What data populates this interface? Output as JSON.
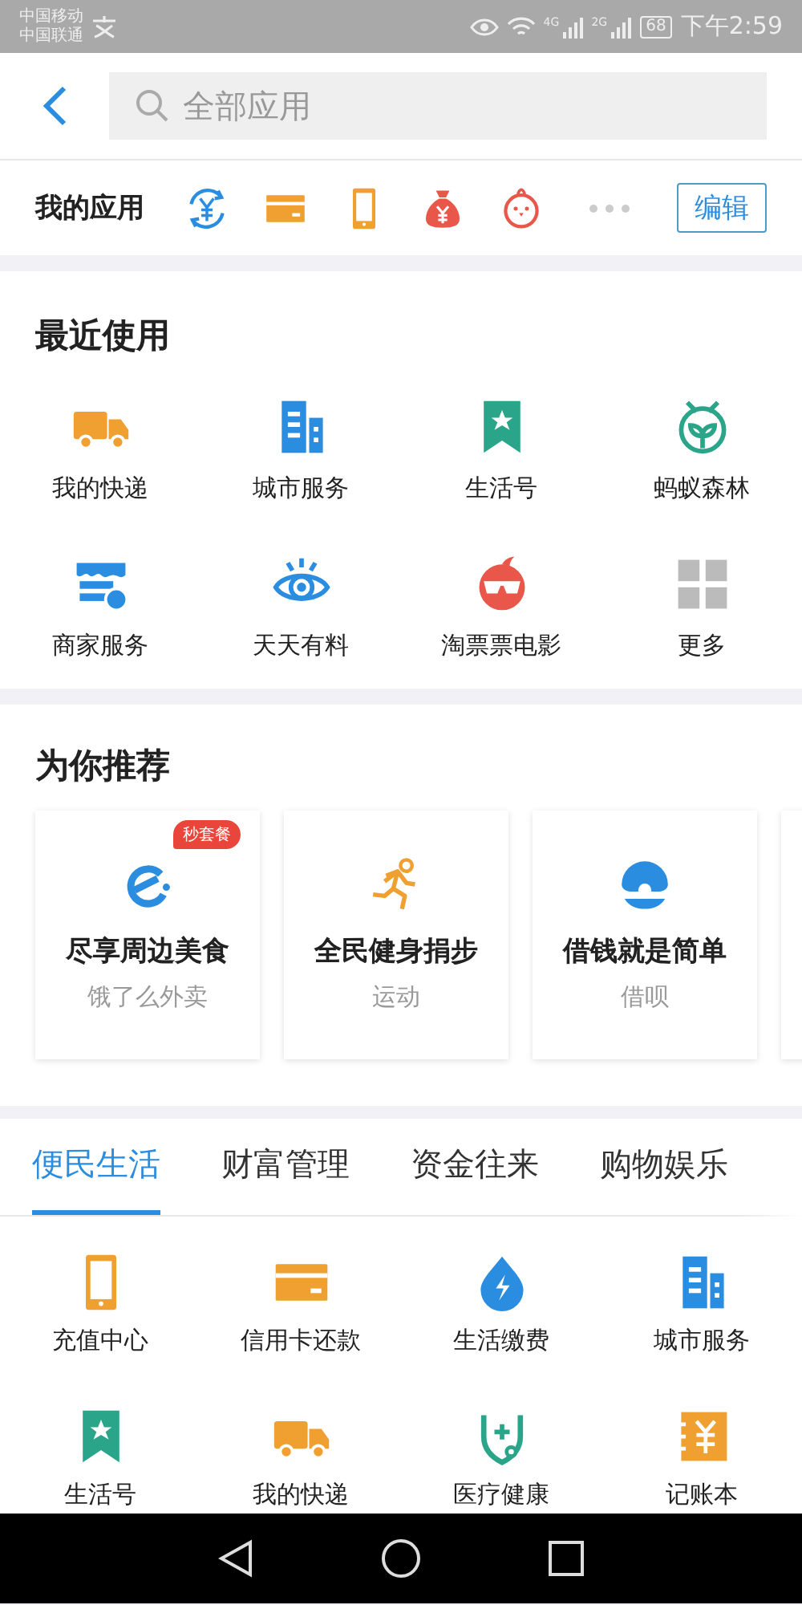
{
  "status_bar": {
    "carriers": [
      "中国移动",
      "中国联通"
    ],
    "network_labels": [
      "4G",
      "2G"
    ],
    "battery": "68",
    "time": "下午2:59"
  },
  "header": {
    "search": {
      "placeholder": "全部应用"
    }
  },
  "my_apps": {
    "title": "我的应用",
    "edit_button": "编辑"
  },
  "recent": {
    "title": "最近使用",
    "items": [
      {
        "label": "我的快递"
      },
      {
        "label": "城市服务"
      },
      {
        "label": "生活号"
      },
      {
        "label": "蚂蚁森林"
      },
      {
        "label": "商家服务"
      },
      {
        "label": "天天有料"
      },
      {
        "label": "淘票票电影"
      },
      {
        "label": "更多"
      }
    ]
  },
  "recommend": {
    "title": "为你推荐",
    "cards": [
      {
        "title": "尽享周边美食",
        "subtitle": "饿了么外卖",
        "badge": "秒套餐"
      },
      {
        "title": "全民健身捐步",
        "subtitle": "运动"
      },
      {
        "title": "借钱就是简单",
        "subtitle": "借呗"
      }
    ]
  },
  "category_tabs": [
    {
      "label": "便民生活",
      "selected": true
    },
    {
      "label": "财富管理",
      "selected": false
    },
    {
      "label": "资金往来",
      "selected": false
    },
    {
      "label": "购物娱乐",
      "selected": false
    }
  ],
  "apps": [
    {
      "label": "充值中心"
    },
    {
      "label": "信用卡还款"
    },
    {
      "label": "生活缴费"
    },
    {
      "label": "城市服务"
    },
    {
      "label": "生活号"
    },
    {
      "label": "我的快递"
    },
    {
      "label": "医疗健康"
    },
    {
      "label": "记账本"
    }
  ]
}
